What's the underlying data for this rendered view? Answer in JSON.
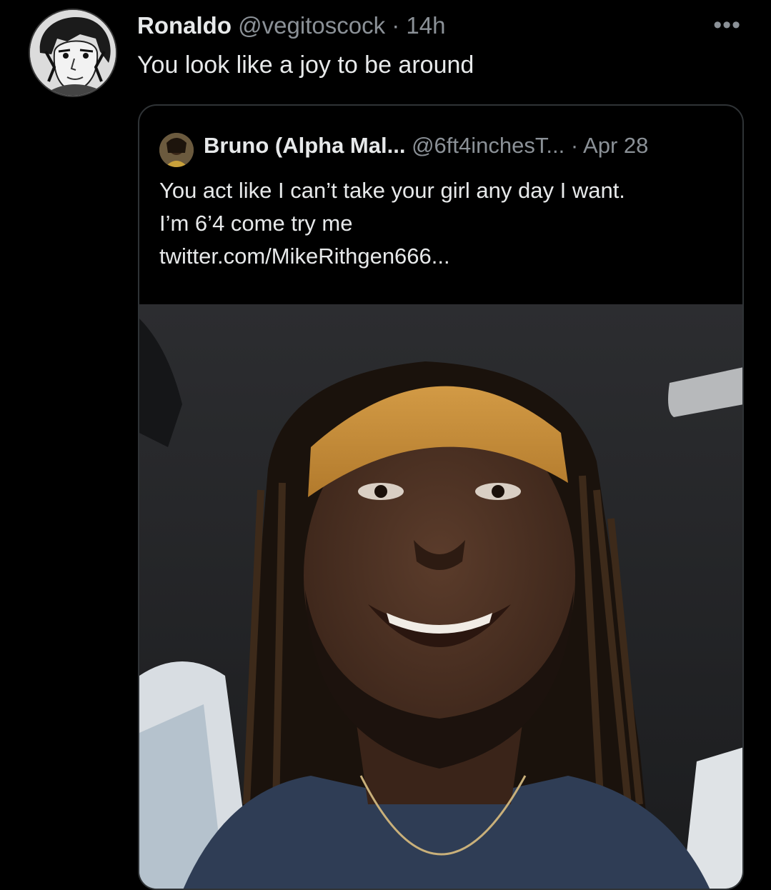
{
  "reply": {
    "author_name": "Ronaldo",
    "author_handle": "@vegitoscock",
    "separator": "·",
    "time": "14h",
    "text": "You look like a joy to be around",
    "more_icon": "more-horizontal-icon"
  },
  "quoted": {
    "author_name": "Bruno (Alpha Mal...",
    "author_handle": "@6ft4inchesT...",
    "separator": "·",
    "time": "Apr 28",
    "text_lines": [
      "You act like I can’t take your girl any day I want.",
      "I’m 6’4 come try me",
      "twitter.com/MikeRithgen666..."
    ]
  },
  "colors": {
    "background": "#000000",
    "text_primary": "#e7e9ea",
    "text_secondary": "#8b9197",
    "border": "#2f3336"
  }
}
